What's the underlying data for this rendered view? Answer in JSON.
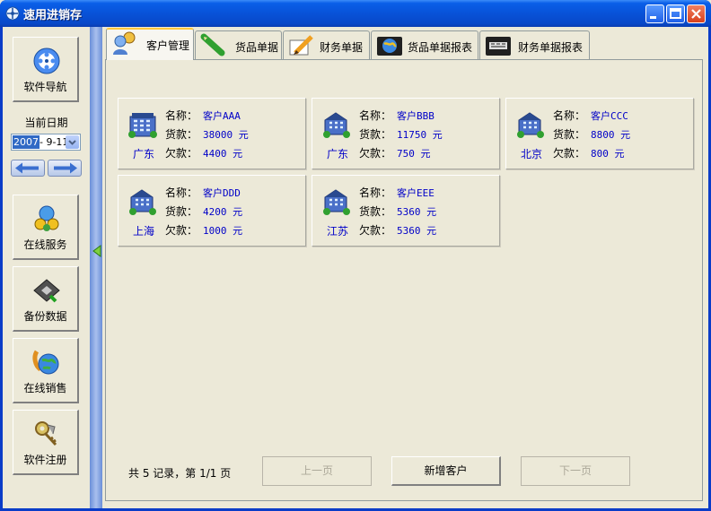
{
  "window": {
    "title": "速用进销存"
  },
  "nav": {
    "software_nav": "软件导航",
    "date_label": "当前日期",
    "date_year": "2007",
    "date_rest": "- 9-11",
    "online_service": "在线服务",
    "backup": "备份数据",
    "online_sales": "在线销售",
    "register": "软件注册"
  },
  "tabs": [
    "客户管理",
    "货品单据",
    "财务单据",
    "货品单据报表",
    "财务单据报表"
  ],
  "labels": {
    "name": "名称：",
    "goods": "货款：",
    "debt": "欠款："
  },
  "customers": [
    {
      "name": "客户AAA",
      "goods": "38000 元",
      "region": "广东",
      "debt": "4400 元"
    },
    {
      "name": "客户BBB",
      "goods": "11750 元",
      "region": "广东",
      "debt": "750 元"
    },
    {
      "name": "客户CCC",
      "goods": "8800 元",
      "region": "北京",
      "debt": "800 元"
    },
    {
      "name": "客户DDD",
      "goods": "4200 元",
      "region": "上海",
      "debt": "1000 元"
    },
    {
      "name": "客户EEE",
      "goods": "5360 元",
      "region": "江苏",
      "debt": "5360 元"
    }
  ],
  "footer": {
    "info": "共 5 记录，第 1/1 页",
    "prev": "上一页",
    "add": "新增客户",
    "next": "下一页"
  }
}
